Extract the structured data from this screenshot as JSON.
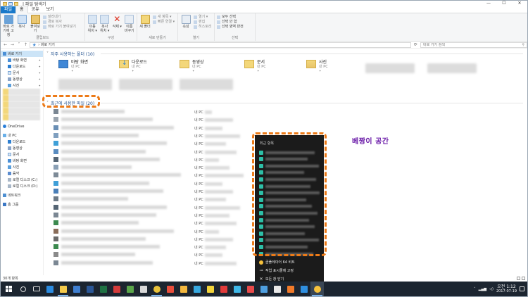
{
  "window": {
    "title": "| 파일 탐색기",
    "controls": [
      "—",
      "☐",
      "✕"
    ]
  },
  "ribbon": {
    "tabs": [
      "파일",
      "홈",
      "공유",
      "보기"
    ],
    "groups": {
      "clipboard": {
        "name": "클립보드",
        "pin": "바로 가기에 고정",
        "copy": "복사",
        "paste": "붙여넣기",
        "cut": "잘라내기",
        "copy_path": "경로 복사",
        "paste_shortcut": "바로 가기 붙여넣기"
      },
      "organize": {
        "name": "구성",
        "move": "이동 위치 ▾",
        "copyto": "복사 위치 ▾",
        "delete": "삭제 ▾",
        "rename": "이름 바꾸기"
      },
      "new": {
        "name": "새로 만들기",
        "newfolder": "새 폴더",
        "newitem": "새 항목 ▾",
        "easy": "빠른 연결 ▾"
      },
      "open": {
        "name": "열기",
        "props": "속성",
        "open": "열기 ▾",
        "edit": "편집",
        "history": "히스토리"
      },
      "select": {
        "name": "선택",
        "all": "모두 선택",
        "none": "선택 안 함",
        "invert": "선택 영역 반전"
      }
    }
  },
  "address": {
    "path": "› 바로 가기",
    "search_placeholder": "바로 가기 검색",
    "search_icon": "search-icon"
  },
  "sidebar": {
    "quick_access": "바로 가기",
    "pinned": [
      {
        "label": "바탕 화면",
        "icon": "desktop-icon"
      },
      {
        "label": "다운로드",
        "icon": "download-icon"
      },
      {
        "label": "문서",
        "icon": "document-icon"
      },
      {
        "label": "동영상",
        "icon": "video-icon"
      },
      {
        "label": "사진",
        "icon": "picture-icon"
      }
    ],
    "onedrive": "OneDrive",
    "this_pc": "내 PC",
    "pc_items": [
      {
        "label": "다운로드",
        "icon": "download-icon"
      },
      {
        "label": "동영상",
        "icon": "video-icon"
      },
      {
        "label": "문서",
        "icon": "document-icon"
      },
      {
        "label": "바탕 화면",
        "icon": "desktop-icon"
      },
      {
        "label": "사진",
        "icon": "picture-icon"
      },
      {
        "label": "음악",
        "icon": "music-icon"
      },
      {
        "label": "로컬 디스크 (C:)",
        "icon": "disk-icon"
      },
      {
        "label": "로컬 디스크 (D:)",
        "icon": "disk-icon"
      }
    ],
    "network": "네트워크",
    "homegroup": "홈 그룹"
  },
  "content": {
    "frequent_header": "자주 사용하는 폴더 (10)",
    "frequent": [
      {
        "name": "바탕 화면",
        "sub": "내 PC",
        "icon": "desktop-folder-icon"
      },
      {
        "name": "다운로드",
        "sub": "내 PC",
        "icon": "download-folder-icon"
      },
      {
        "name": "동영상",
        "sub": "내 PC",
        "icon": "video-folder-icon"
      },
      {
        "name": "문서",
        "sub": "내 PC",
        "icon": "document-folder-icon"
      },
      {
        "name": "사진",
        "sub": "내 PC",
        "icon": "picture-folder-icon"
      }
    ],
    "recent_header": "최근에 사용한 파일 (20)",
    "recent_location": "내 PC",
    "annotation": "베짱이 공간"
  },
  "jumplist": {
    "header": "최근 항목",
    "app_name": "곰플레이어 64 비트",
    "pin_action": "작업 표시줄에 고정",
    "close_action": "모든 창 닫기"
  },
  "status": {
    "count": "30개 항목"
  },
  "taskbar": {
    "clock_time": "오전 1:12",
    "clock_date": "2017-07-19",
    "apps": [
      {
        "name": "edge-icon",
        "color": "#2b8be0"
      },
      {
        "name": "file-explorer-icon",
        "color": "#f3c94a"
      },
      {
        "name": "store-icon",
        "color": "#3f7fd0"
      },
      {
        "name": "word-icon",
        "color": "#2b5797"
      },
      {
        "name": "excel-icon",
        "color": "#1f7244"
      },
      {
        "name": "app-icon",
        "color": "#d43b3b"
      },
      {
        "name": "app-icon",
        "color": "#5aa64a"
      },
      {
        "name": "app-icon",
        "color": "#d8d8d8"
      },
      {
        "name": "chrome-icon",
        "color": "#e8c23a"
      },
      {
        "name": "app-icon",
        "color": "#e94e3c"
      },
      {
        "name": "app-icon",
        "color": "#f2b73e"
      },
      {
        "name": "app-icon",
        "color": "#37a9e0"
      },
      {
        "name": "app-icon",
        "color": "#f1d33a"
      },
      {
        "name": "app-icon",
        "color": "#e03a3a"
      },
      {
        "name": "app-icon",
        "color": "#3fb8e8"
      },
      {
        "name": "app-icon",
        "color": "#e84a4a"
      },
      {
        "name": "app-icon",
        "color": "#4e9fe0"
      },
      {
        "name": "app-icon",
        "color": "#e8e8e8"
      },
      {
        "name": "app-icon",
        "color": "#f07a2a"
      },
      {
        "name": "app-icon",
        "color": "#2f8fe0"
      },
      {
        "name": "gom-player-icon",
        "color": "#f7c23c"
      }
    ]
  },
  "colors": {
    "accent": "#1979ca",
    "highlight_dash": "#ec7a17",
    "annotation": "#6a1aa8",
    "taskbar": "#1c2530",
    "jumplist_bg": "#1b1b1b"
  }
}
